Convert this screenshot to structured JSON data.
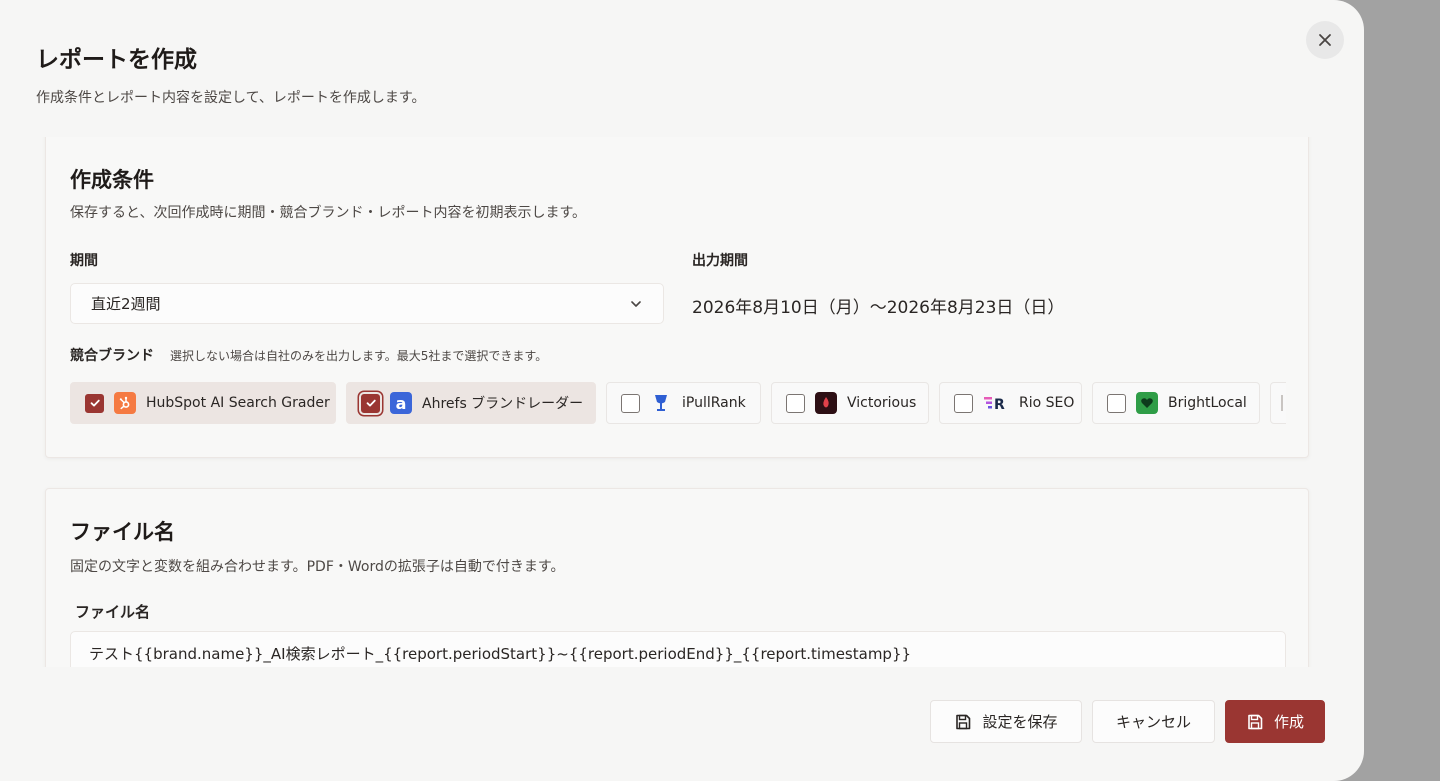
{
  "dialog": {
    "title": "レポートを作成",
    "description": "作成条件とレポート内容を設定して、レポートを作成します。",
    "close_icon": "close-icon"
  },
  "conditions": {
    "title": "作成条件",
    "subtitle": "保存すると、次回作成時に期間・競合ブランド・レポート内容を初期表示します。",
    "period_label": "期間",
    "period_value": "直近2週間",
    "output_label": "出力期間",
    "output_value": "2026年8月10日（月）〜2026年8月23日（日）",
    "competitors_label": "競合ブランド",
    "competitors_hint": "選択しない場合は自社のみを出力します。最大5社まで選択できます。",
    "brands": [
      {
        "name": "HubSpot AI Search Grader",
        "checked": true,
        "logo_color": "#f57a42",
        "logo_glyph": "⚙"
      },
      {
        "name": "Ahrefs ブランドレーダー",
        "checked": true,
        "logo_color": "#3b66d9",
        "logo_glyph": "a"
      },
      {
        "name": "iPullRank",
        "checked": false,
        "logo_color": "#2f5fd3",
        "logo_glyph": "♆"
      },
      {
        "name": "Victorious",
        "checked": false,
        "logo_color": "#2d0f14",
        "logo_glyph": "♦"
      },
      {
        "name": "Rio SEO",
        "checked": false,
        "logo_color": "#e65bb8",
        "logo_glyph": "R"
      },
      {
        "name": "BrightLocal",
        "checked": false,
        "logo_color": "#2f9d47",
        "logo_glyph": "♥"
      }
    ]
  },
  "file": {
    "title": "ファイル名",
    "subtitle": "固定の文字と変数を組み合わせます。PDF・Wordの拡張子は自動で付きます。",
    "field_label": "ファイル名",
    "value": "テスト{{brand.name}}_AI検索レポート_{{report.periodStart}}~{{report.periodEnd}}_{{report.timestamp}}"
  },
  "footer": {
    "save_label": "設定を保存",
    "cancel_label": "キャンセル",
    "create_label": "作成"
  },
  "colors": {
    "accent": "#9a3632",
    "selected_chip": "#ece5e2",
    "modal_bg": "#f6f6f5",
    "overlay": "#a2a2a2"
  }
}
